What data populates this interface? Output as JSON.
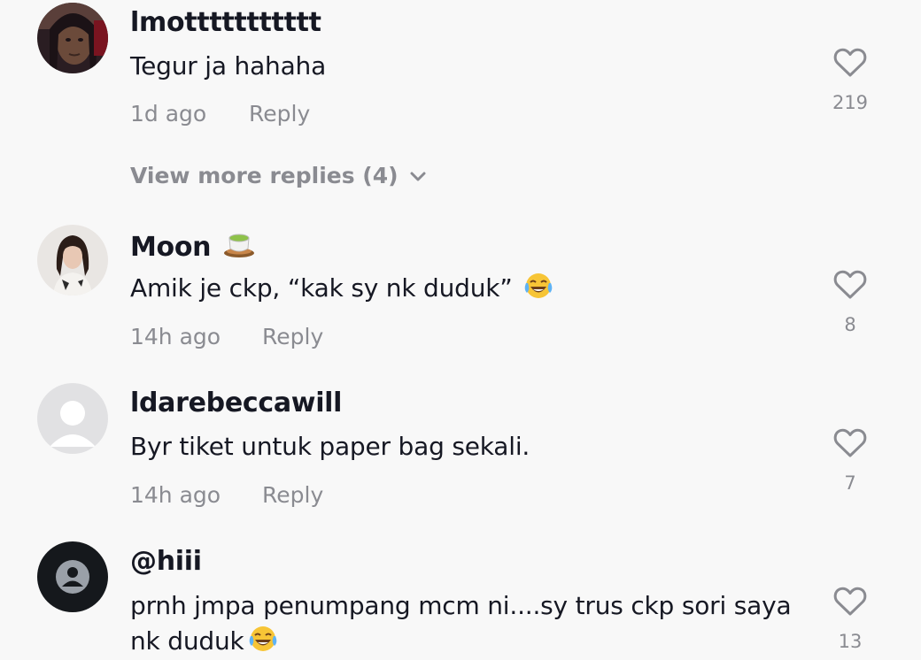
{
  "comments": [
    {
      "username": "lmottttttttttt",
      "text": "Tegur ja hahaha",
      "time": "1d ago",
      "reply": "Reply",
      "likes": "219",
      "avatar": "user-photo-avatar"
    },
    {
      "username": "Moon",
      "username_emoji": "teacup-emoji",
      "text": "Amik je ckp, “kak sy nk duduk”",
      "text_emoji": "tears-of-joy-emoji",
      "time": "14h ago",
      "reply": "Reply",
      "likes": "8",
      "avatar": "user-photo-avatar"
    },
    {
      "username": "ldarebeccawill",
      "text": "Byr tiket untuk paper bag sekali.",
      "time": "14h ago",
      "reply": "Reply",
      "likes": "7",
      "avatar": "default-avatar"
    },
    {
      "username": "@hiii",
      "text": "prnh jmpa penumpang mcm ni....sy trus ckp sori saya nk duduk",
      "text_emoji": "tears-of-joy-emoji",
      "likes": "13",
      "avatar": "dark-default-avatar"
    }
  ],
  "view_more": {
    "label": "View more replies (4)"
  },
  "colors": {
    "background": "#f8f8f8",
    "primary_text": "#161823",
    "secondary_text": "#8a8b91"
  }
}
